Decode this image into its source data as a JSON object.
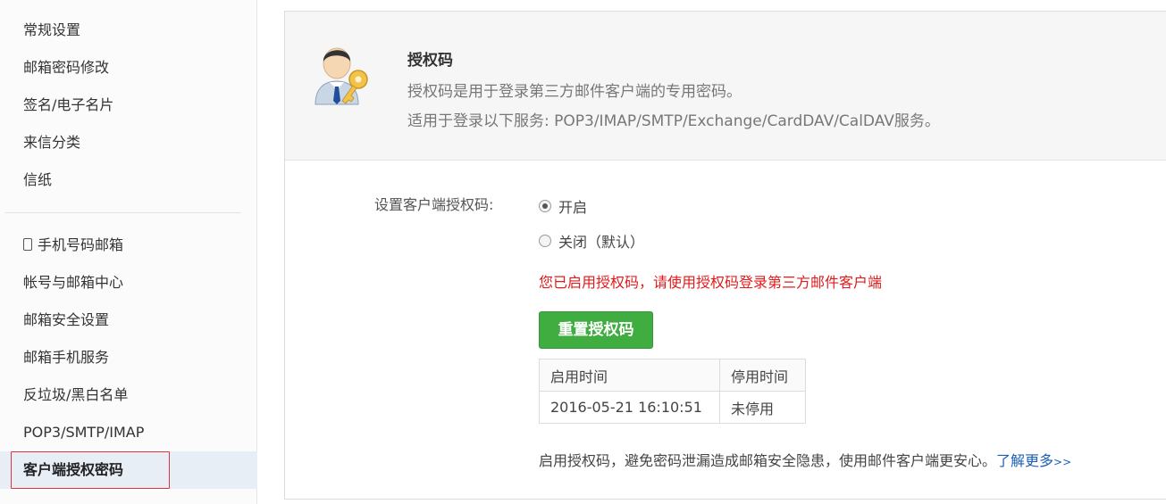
{
  "sidebar": {
    "group1": [
      "常规设置",
      "邮箱密码修改",
      "签名/电子名片",
      "来信分类",
      "信纸"
    ],
    "group2": [
      "手机号码邮箱",
      "帐号与邮箱中心",
      "邮箱安全设置",
      "邮箱手机服务",
      "反垃圾/黑白名单",
      "POP3/SMTP/IMAP",
      "客户端授权密码"
    ],
    "active_item": "客户端授权密码"
  },
  "header": {
    "title": "授权码",
    "desc1": "授权码是用于登录第三方邮件客户端的专用密码。",
    "desc2": "适用于登录以下服务: POP3/IMAP/SMTP/Exchange/CardDAV/CalDAV服务。"
  },
  "form": {
    "label": "设置客户端授权码:",
    "option_on": "开启",
    "option_off": "关闭（默认）",
    "selected": "开启",
    "notice": "您已启用授权码，请使用授权码登录第三方邮件客户端",
    "reset_button": "重置授权码"
  },
  "table": {
    "headers": [
      "启用时间",
      "停用时间"
    ],
    "rows": [
      [
        "2016-05-21 16:10:51",
        "未停用"
      ]
    ]
  },
  "footer": {
    "text": "启用授权码，避免密码泄漏造成邮箱安全隐患，使用邮件客户端更安心。",
    "link": "了解更多",
    "link_arrows": ">>"
  },
  "colors": {
    "accent_green": "#3fad3f",
    "notice_red": "#e11b1b",
    "link_blue": "#1a5fb4",
    "highlight_outline": "#e0353b"
  }
}
